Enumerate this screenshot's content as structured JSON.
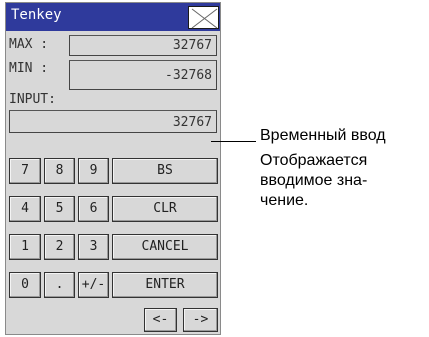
{
  "dialog": {
    "title": "Tenkey",
    "max_label": "MAX :",
    "max_value": "32767",
    "min_label": "MIN :",
    "min_value": "-32768",
    "input_label": "INPUT:",
    "input_value": "32767"
  },
  "keypad": {
    "row1": [
      "7",
      "8",
      "9",
      "BS"
    ],
    "row2": [
      "4",
      "5",
      "6",
      "CLR"
    ],
    "row3": [
      "1",
      "2",
      "3",
      "CANCEL"
    ],
    "row4": [
      "0",
      ".",
      "+/-",
      "ENTER"
    ],
    "left_arrow": "<-",
    "right_arrow": "->"
  },
  "annotation": {
    "title": "Временный ввод",
    "line1": "Отображается",
    "line2": "вводимое зна-",
    "line3": "чение."
  }
}
